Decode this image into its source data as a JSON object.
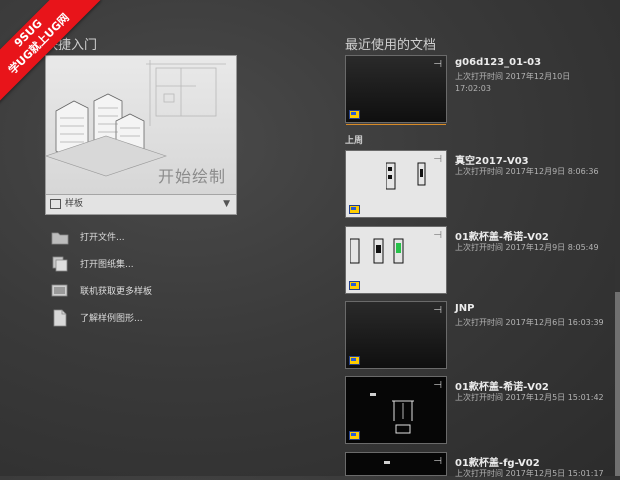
{
  "watermark": {
    "line1": "9SUG",
    "line2": "学UG就上UG网"
  },
  "quick_start": {
    "title": "快捷入门",
    "start_label": "开始绘制",
    "template_label": "样板",
    "actions": [
      {
        "label": "打开文件...",
        "icon": "folder-icon"
      },
      {
        "label": "打开图纸集...",
        "icon": "sheet-set-icon"
      },
      {
        "label": "联机获取更多样板",
        "icon": "online-templates-icon"
      },
      {
        "label": "了解样例图形...",
        "icon": "sample-drawings-icon"
      }
    ]
  },
  "recent": {
    "title": "最近使用的文档",
    "group_last_week": "上周",
    "items": [
      {
        "name": "g06d123_01-03",
        "time": "上次打开时间 2017年12月10日 17:02:03"
      },
      {
        "name": "真空2017-V03",
        "time": "上次打开时间 2017年12月9日 8:06:36"
      },
      {
        "name": "01款杯盖-希诺-V02",
        "time": "上次打开时间 2017年12月9日 8:05:49"
      },
      {
        "name": "JNP",
        "time": "上次打开时间 2017年12月6日 16:03:39"
      },
      {
        "name": "01款杯盖-希诺-V02",
        "time": "上次打开时间 2017年12月5日 15:01:42"
      },
      {
        "name": "01款杯盖-fg-V02",
        "time": "上次打开时间 2017年12月5日 15:01:17"
      }
    ]
  },
  "colors": {
    "accent_orange": "#d98a25",
    "watermark_red": "#e8141a"
  }
}
